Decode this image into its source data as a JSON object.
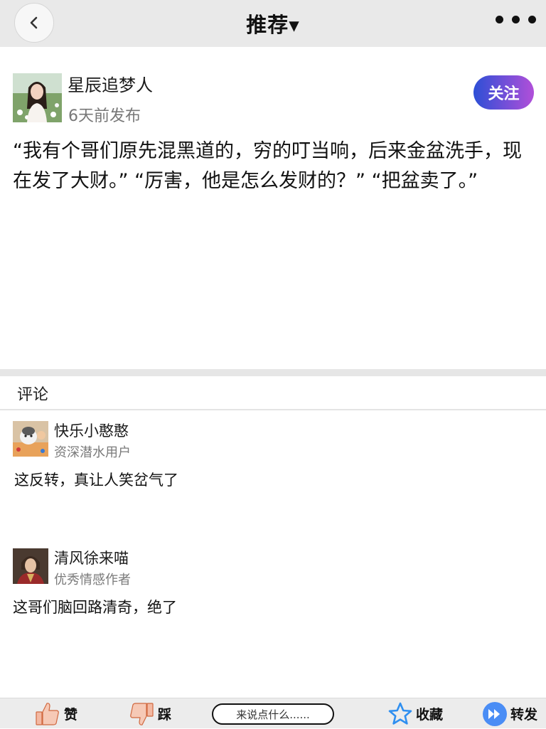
{
  "header": {
    "title": "推荐▾"
  },
  "post": {
    "author_name": "星辰追梦人",
    "time": "6天前发布",
    "follow_label": "关注",
    "content": "“我有个哥们原先混黑道的，穷的叮当响，后来金盆洗手，现在发了大财。” “厉害，他是怎么发财的？” “把盆卖了。”"
  },
  "comments": {
    "heading": "评论",
    "items": [
      {
        "name": "快乐小憨憨",
        "title": "资深潜水用户",
        "text": "这反转，真让人笑岔气了"
      },
      {
        "name": "清风徐来喵",
        "title": "优秀情感作者",
        "text": "这哥们脑回路清奇，绝了"
      }
    ]
  },
  "bottom_bar": {
    "like_label": "赞",
    "dislike_label": "踩",
    "input_placeholder": "来说点什么......",
    "favorite_label": "收藏",
    "share_label": "转发"
  },
  "colors": {
    "follow_gradient_start": "#2d4fd6",
    "follow_gradient_end": "#b14fd9",
    "header_bg": "#e9e9e9",
    "star_blue": "#2f8ff0",
    "share_blue": "#4a8df5"
  },
  "icons": [
    "back-chevron-icon",
    "more-dots-icon",
    "thumbs-up-icon",
    "thumbs-down-icon",
    "star-icon",
    "share-forward-icon"
  ]
}
